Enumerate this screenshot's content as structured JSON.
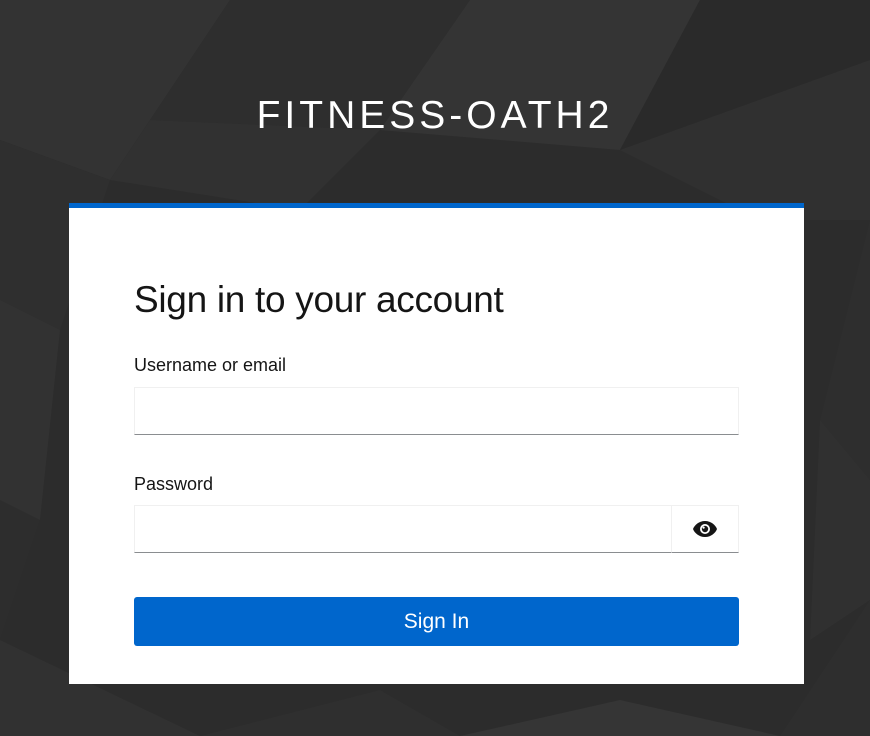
{
  "realm": {
    "title": "FITNESS-OATH2"
  },
  "login": {
    "heading": "Sign in to your account",
    "username_label": "Username or email",
    "username_value": "",
    "password_label": "Password",
    "password_value": "",
    "show_password_icon": "eye-icon",
    "submit_label": "Sign In"
  },
  "colors": {
    "background": "#2b2b2b",
    "accent": "#0066cc",
    "card": "#ffffff"
  }
}
